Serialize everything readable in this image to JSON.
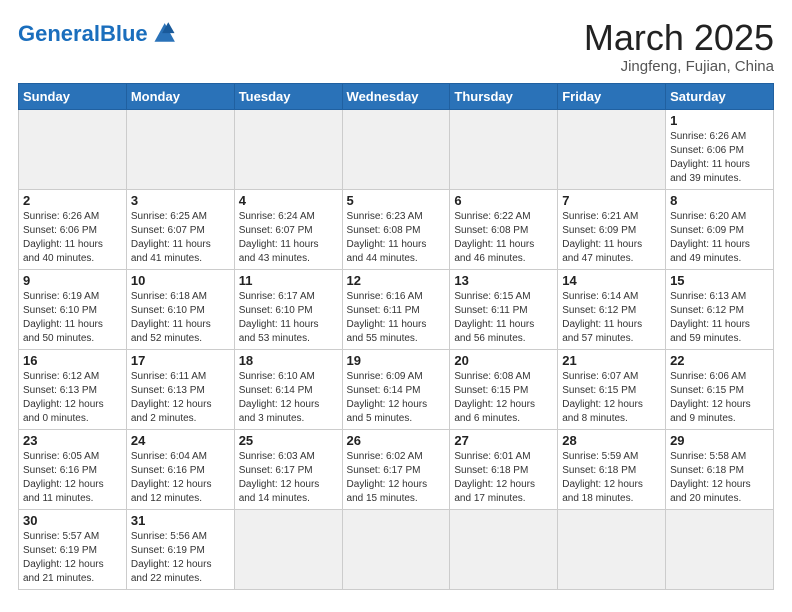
{
  "header": {
    "logo_general": "General",
    "logo_blue": "Blue",
    "month": "March 2025",
    "location": "Jingfeng, Fujian, China"
  },
  "weekdays": [
    "Sunday",
    "Monday",
    "Tuesday",
    "Wednesday",
    "Thursday",
    "Friday",
    "Saturday"
  ],
  "weeks": [
    [
      {
        "day": "",
        "info": "",
        "empty": true
      },
      {
        "day": "",
        "info": "",
        "empty": true
      },
      {
        "day": "",
        "info": "",
        "empty": true
      },
      {
        "day": "",
        "info": "",
        "empty": true
      },
      {
        "day": "",
        "info": "",
        "empty": true
      },
      {
        "day": "",
        "info": "",
        "empty": true
      },
      {
        "day": "1",
        "info": "Sunrise: 6:26 AM\nSunset: 6:06 PM\nDaylight: 11 hours and 39 minutes.",
        "empty": false
      }
    ],
    [
      {
        "day": "2",
        "info": "Sunrise: 6:26 AM\nSunset: 6:06 PM\nDaylight: 11 hours and 40 minutes.",
        "empty": false
      },
      {
        "day": "3",
        "info": "Sunrise: 6:25 AM\nSunset: 6:07 PM\nDaylight: 11 hours and 41 minutes.",
        "empty": false
      },
      {
        "day": "4",
        "info": "Sunrise: 6:24 AM\nSunset: 6:07 PM\nDaylight: 11 hours and 43 minutes.",
        "empty": false
      },
      {
        "day": "5",
        "info": "Sunrise: 6:23 AM\nSunset: 6:08 PM\nDaylight: 11 hours and 44 minutes.",
        "empty": false
      },
      {
        "day": "6",
        "info": "Sunrise: 6:22 AM\nSunset: 6:08 PM\nDaylight: 11 hours and 46 minutes.",
        "empty": false
      },
      {
        "day": "7",
        "info": "Sunrise: 6:21 AM\nSunset: 6:09 PM\nDaylight: 11 hours and 47 minutes.",
        "empty": false
      },
      {
        "day": "8",
        "info": "Sunrise: 6:20 AM\nSunset: 6:09 PM\nDaylight: 11 hours and 49 minutes.",
        "empty": false
      }
    ],
    [
      {
        "day": "9",
        "info": "Sunrise: 6:19 AM\nSunset: 6:10 PM\nDaylight: 11 hours and 50 minutes.",
        "empty": false
      },
      {
        "day": "10",
        "info": "Sunrise: 6:18 AM\nSunset: 6:10 PM\nDaylight: 11 hours and 52 minutes.",
        "empty": false
      },
      {
        "day": "11",
        "info": "Sunrise: 6:17 AM\nSunset: 6:10 PM\nDaylight: 11 hours and 53 minutes.",
        "empty": false
      },
      {
        "day": "12",
        "info": "Sunrise: 6:16 AM\nSunset: 6:11 PM\nDaylight: 11 hours and 55 minutes.",
        "empty": false
      },
      {
        "day": "13",
        "info": "Sunrise: 6:15 AM\nSunset: 6:11 PM\nDaylight: 11 hours and 56 minutes.",
        "empty": false
      },
      {
        "day": "14",
        "info": "Sunrise: 6:14 AM\nSunset: 6:12 PM\nDaylight: 11 hours and 57 minutes.",
        "empty": false
      },
      {
        "day": "15",
        "info": "Sunrise: 6:13 AM\nSunset: 6:12 PM\nDaylight: 11 hours and 59 minutes.",
        "empty": false
      }
    ],
    [
      {
        "day": "16",
        "info": "Sunrise: 6:12 AM\nSunset: 6:13 PM\nDaylight: 12 hours and 0 minutes.",
        "empty": false
      },
      {
        "day": "17",
        "info": "Sunrise: 6:11 AM\nSunset: 6:13 PM\nDaylight: 12 hours and 2 minutes.",
        "empty": false
      },
      {
        "day": "18",
        "info": "Sunrise: 6:10 AM\nSunset: 6:14 PM\nDaylight: 12 hours and 3 minutes.",
        "empty": false
      },
      {
        "day": "19",
        "info": "Sunrise: 6:09 AM\nSunset: 6:14 PM\nDaylight: 12 hours and 5 minutes.",
        "empty": false
      },
      {
        "day": "20",
        "info": "Sunrise: 6:08 AM\nSunset: 6:15 PM\nDaylight: 12 hours and 6 minutes.",
        "empty": false
      },
      {
        "day": "21",
        "info": "Sunrise: 6:07 AM\nSunset: 6:15 PM\nDaylight: 12 hours and 8 minutes.",
        "empty": false
      },
      {
        "day": "22",
        "info": "Sunrise: 6:06 AM\nSunset: 6:15 PM\nDaylight: 12 hours and 9 minutes.",
        "empty": false
      }
    ],
    [
      {
        "day": "23",
        "info": "Sunrise: 6:05 AM\nSunset: 6:16 PM\nDaylight: 12 hours and 11 minutes.",
        "empty": false
      },
      {
        "day": "24",
        "info": "Sunrise: 6:04 AM\nSunset: 6:16 PM\nDaylight: 12 hours and 12 minutes.",
        "empty": false
      },
      {
        "day": "25",
        "info": "Sunrise: 6:03 AM\nSunset: 6:17 PM\nDaylight: 12 hours and 14 minutes.",
        "empty": false
      },
      {
        "day": "26",
        "info": "Sunrise: 6:02 AM\nSunset: 6:17 PM\nDaylight: 12 hours and 15 minutes.",
        "empty": false
      },
      {
        "day": "27",
        "info": "Sunrise: 6:01 AM\nSunset: 6:18 PM\nDaylight: 12 hours and 17 minutes.",
        "empty": false
      },
      {
        "day": "28",
        "info": "Sunrise: 5:59 AM\nSunset: 6:18 PM\nDaylight: 12 hours and 18 minutes.",
        "empty": false
      },
      {
        "day": "29",
        "info": "Sunrise: 5:58 AM\nSunset: 6:18 PM\nDaylight: 12 hours and 20 minutes.",
        "empty": false
      }
    ],
    [
      {
        "day": "30",
        "info": "Sunrise: 5:57 AM\nSunset: 6:19 PM\nDaylight: 12 hours and 21 minutes.",
        "empty": false
      },
      {
        "day": "31",
        "info": "Sunrise: 5:56 AM\nSunset: 6:19 PM\nDaylight: 12 hours and 22 minutes.",
        "empty": false
      },
      {
        "day": "",
        "info": "",
        "empty": true
      },
      {
        "day": "",
        "info": "",
        "empty": true
      },
      {
        "day": "",
        "info": "",
        "empty": true
      },
      {
        "day": "",
        "info": "",
        "empty": true
      },
      {
        "day": "",
        "info": "",
        "empty": true
      }
    ]
  ]
}
